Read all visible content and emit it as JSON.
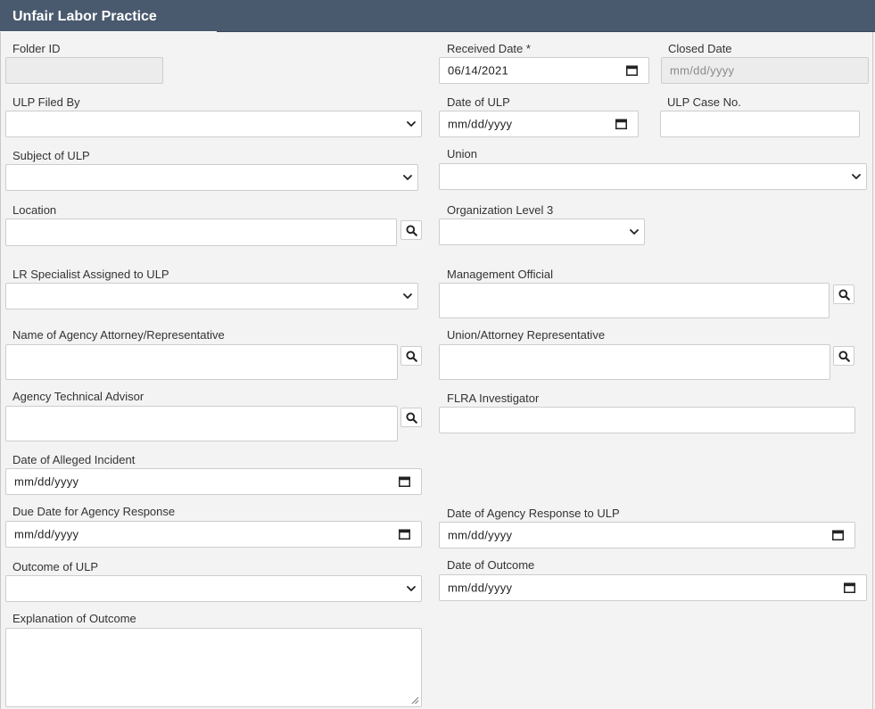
{
  "header": {
    "title": "Unfair Labor Practice"
  },
  "fields": {
    "folder_id": {
      "label": "Folder ID",
      "value": ""
    },
    "received_date": {
      "label": "Received Date *",
      "value": "06/14/2021"
    },
    "closed_date": {
      "label": "Closed Date",
      "placeholder": "mm/dd/yyyy"
    },
    "ulp_filed_by": {
      "label": "ULP Filed By",
      "value": ""
    },
    "date_of_ulp": {
      "label": "Date of ULP",
      "placeholder": "mm/dd/yyyy"
    },
    "ulp_case_no": {
      "label": "ULP Case No.",
      "value": ""
    },
    "subject_of_ulp": {
      "label": "Subject of ULP",
      "value": ""
    },
    "union": {
      "label": "Union",
      "value": ""
    },
    "location": {
      "label": "Location",
      "value": ""
    },
    "org_level_3": {
      "label": "Organization Level 3",
      "value": ""
    },
    "lr_specialist": {
      "label": "LR Specialist Assigned to ULP",
      "value": ""
    },
    "management_official": {
      "label": "Management Official",
      "value": ""
    },
    "agency_attorney": {
      "label": "Name of Agency Attorney/Representative",
      "value": ""
    },
    "union_attorney": {
      "label": "Union/Attorney Representative",
      "value": ""
    },
    "agency_tech_advisor": {
      "label": "Agency Technical Advisor",
      "value": ""
    },
    "flra_investigator": {
      "label": "FLRA Investigator",
      "value": ""
    },
    "date_alleged_incident": {
      "label": "Date of Alleged Incident",
      "placeholder": "mm/dd/yyyy"
    },
    "due_date_agency_response": {
      "label": "Due Date for Agency Response",
      "placeholder": "mm/dd/yyyy"
    },
    "date_agency_response": {
      "label": "Date of Agency Response to ULP",
      "placeholder": "mm/dd/yyyy"
    },
    "outcome_of_ulp": {
      "label": "Outcome of ULP",
      "value": ""
    },
    "date_of_outcome": {
      "label": "Date of Outcome",
      "placeholder": "mm/dd/yyyy"
    },
    "explanation_of_outcome": {
      "label": "Explanation of Outcome",
      "value": ""
    }
  },
  "icons": {
    "search": "magnifier-icon",
    "calendar": "calendar-icon",
    "dropdown": "chevron-down-icon"
  },
  "colors": {
    "header_bg": "#4a5a6e",
    "page_bg": "#f3f3f3",
    "field_border": "#cdcdcd",
    "disabled_bg": "#ececec"
  }
}
